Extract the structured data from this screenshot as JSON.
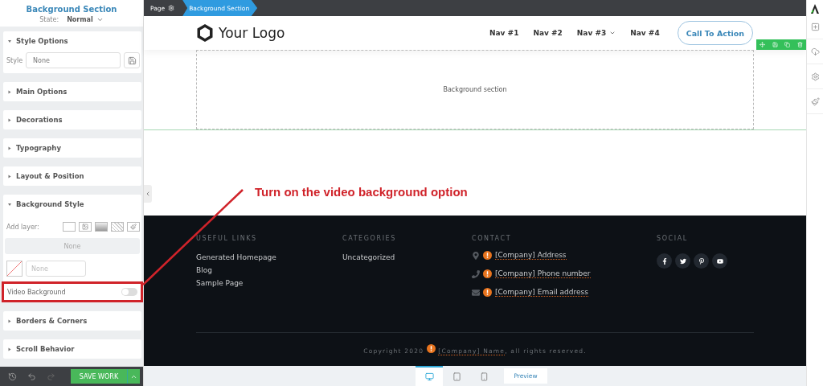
{
  "sidebar": {
    "title": "Background Section",
    "state_label": "State:",
    "state_value": "Normal",
    "sections": [
      {
        "title": "Style Options",
        "expanded": true,
        "kind": "style"
      },
      {
        "title": "Main Options",
        "expanded": false
      },
      {
        "title": "Decorations",
        "expanded": false
      },
      {
        "title": "Typography",
        "expanded": false
      },
      {
        "title": "Layout & Position",
        "expanded": false
      },
      {
        "title": "Background Style",
        "expanded": true,
        "kind": "background"
      },
      {
        "title": "Borders & Corners",
        "expanded": false
      },
      {
        "title": "Scroll Behavior",
        "expanded": false
      }
    ],
    "style": {
      "label": "Style",
      "value": "None"
    },
    "background": {
      "add_layer_label": "Add layer:",
      "layer_value": "None",
      "color_value": "None",
      "video_label": "Video Background",
      "video_on": false
    },
    "save_button": "SAVE WORK"
  },
  "breadcrumb": [
    {
      "label": "Page",
      "selected": false
    },
    {
      "label": "Background Section",
      "selected": true
    }
  ],
  "header": {
    "logo": "Your Logo",
    "nav": [
      {
        "label": "Nav #1",
        "dropdown": false
      },
      {
        "label": "Nav #2",
        "dropdown": false
      },
      {
        "label": "Nav #3",
        "dropdown": true
      },
      {
        "label": "Nav #4",
        "dropdown": false
      }
    ],
    "cta": "Call To Action"
  },
  "section_placeholder": "Background section",
  "annotation": "Turn on the video background option",
  "footer": {
    "columns": [
      {
        "heading": "USEFUL LINKS",
        "kind": "links",
        "links": [
          "Generated Homepage",
          "Blog",
          "Sample Page"
        ]
      },
      {
        "heading": "CATEGORIES",
        "kind": "links",
        "links": [
          "Uncategorized"
        ]
      },
      {
        "heading": "CONTACT",
        "kind": "contact",
        "items": [
          {
            "kind": "address",
            "text": "[Company] Address"
          },
          {
            "kind": "phone",
            "text": "[Company] Phone number"
          },
          {
            "kind": "email",
            "text": "[Company] Email address"
          }
        ]
      },
      {
        "heading": "SOCIAL",
        "kind": "social"
      }
    ],
    "copyright": "Copyright 2020",
    "company": "[Company] Name",
    "rights": ", all rights reserved."
  },
  "devices": [
    {
      "kind": "desktop",
      "selected": true
    },
    {
      "kind": "tablet",
      "selected": false
    },
    {
      "kind": "mobile",
      "selected": false
    }
  ],
  "preview_button": "Preview"
}
